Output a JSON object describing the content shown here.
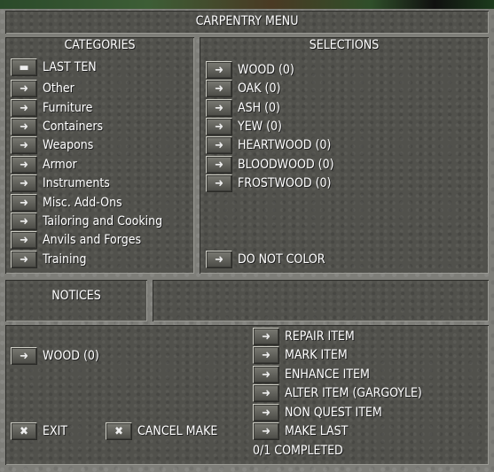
{
  "title": "CARPENTRY MENU",
  "categories": {
    "header": "CATEGORIES",
    "items": [
      {
        "label": "LAST TEN",
        "icon": "list-icon"
      },
      {
        "label": "Other",
        "icon": "arrow-icon"
      },
      {
        "label": "Furniture",
        "icon": "arrow-icon"
      },
      {
        "label": "Containers",
        "icon": "arrow-icon"
      },
      {
        "label": "Weapons",
        "icon": "arrow-icon"
      },
      {
        "label": "Armor",
        "icon": "arrow-icon"
      },
      {
        "label": "Instruments",
        "icon": "arrow-icon"
      },
      {
        "label": "Misc. Add-Ons",
        "icon": "arrow-icon"
      },
      {
        "label": "Tailoring and Cooking",
        "icon": "arrow-icon"
      },
      {
        "label": "Anvils and Forges",
        "icon": "arrow-icon"
      },
      {
        "label": "Training",
        "icon": "arrow-icon"
      }
    ]
  },
  "selections": {
    "header": "SELECTIONS",
    "items": [
      {
        "label": "WOOD (0)"
      },
      {
        "label": "OAK (0)"
      },
      {
        "label": "ASH (0)"
      },
      {
        "label": "YEW (0)"
      },
      {
        "label": "HEARTWOOD (0)"
      },
      {
        "label": "BLOODWOOD (0)"
      },
      {
        "label": "FROSTWOOD (0)"
      }
    ],
    "do_not_color": "DO NOT COLOR"
  },
  "notices": {
    "header": "NOTICES",
    "message": ""
  },
  "bottom": {
    "material": "WOOD (0)",
    "exit": "EXIT",
    "cancel_make": "CANCEL MAKE",
    "actions": [
      "REPAIR ITEM",
      "MARK ITEM",
      "ENHANCE ITEM",
      "ALTER ITEM (GARGOYLE)",
      "NON QUEST ITEM",
      "MAKE LAST"
    ],
    "completed": "0/1 COMPLETED"
  },
  "glyphs": {
    "arrow": "➜",
    "x": "✖",
    "list": "▬"
  }
}
